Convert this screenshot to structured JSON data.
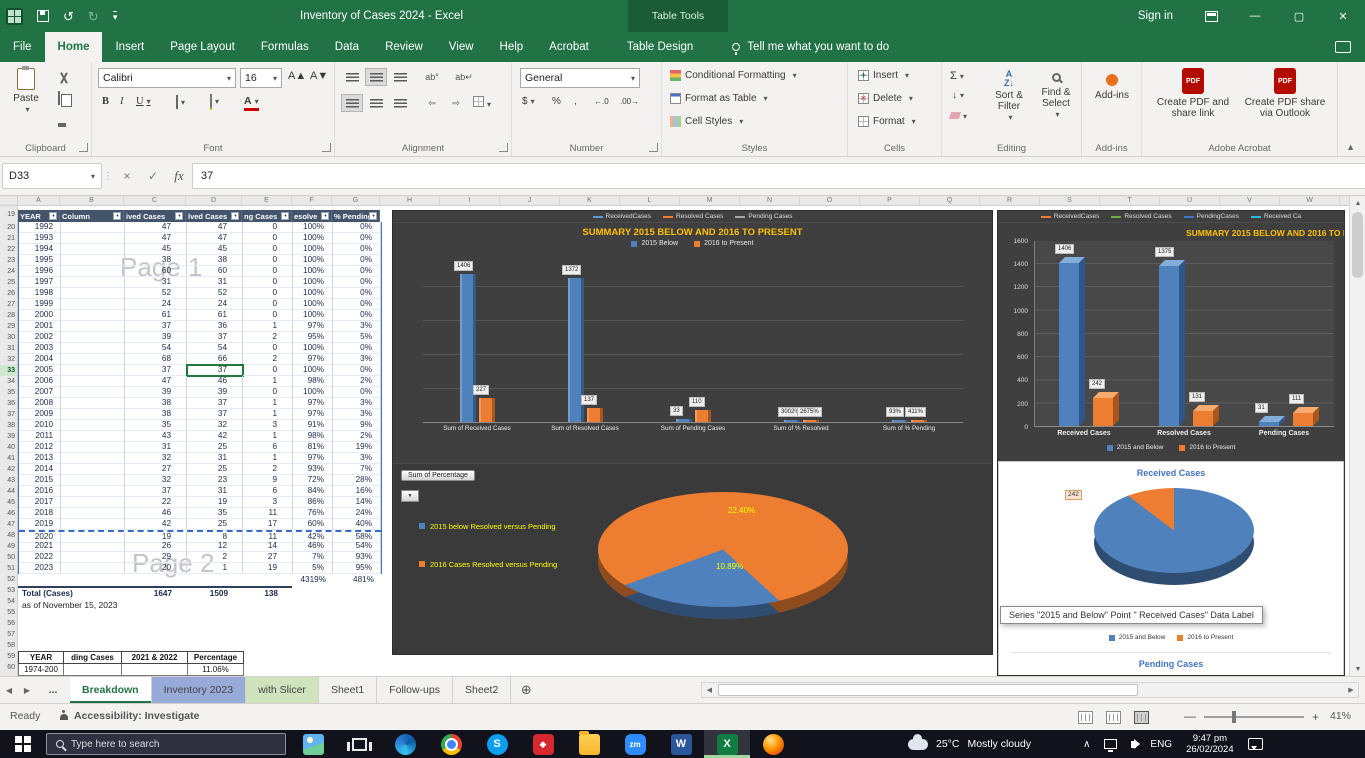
{
  "window": {
    "title": "Inventory of Cases 2024  -  Excel",
    "context_tab_group": "Table Tools",
    "sign_in": "Sign in"
  },
  "ribbon_tabs": [
    {
      "label": "File"
    },
    {
      "label": "Home",
      "active": true
    },
    {
      "label": "Insert"
    },
    {
      "label": "Page Layout"
    },
    {
      "label": "Formulas"
    },
    {
      "label": "Data"
    },
    {
      "label": "Review"
    },
    {
      "label": "View"
    },
    {
      "label": "Help"
    },
    {
      "label": "Acrobat"
    },
    {
      "label": "Table Design",
      "contextual": true
    }
  ],
  "tell_me": "Tell me what you want to do",
  "ribbon": {
    "clipboard": {
      "group": "Clipboard",
      "paste": "Paste"
    },
    "font": {
      "group": "Font",
      "family": "Calibri",
      "size": "16"
    },
    "alignment": {
      "group": "Alignment"
    },
    "number": {
      "group": "Number",
      "format": "General"
    },
    "styles": {
      "group": "Styles",
      "conditional": "Conditional Formatting",
      "format_table": "Format as Table",
      "cell_styles": "Cell Styles"
    },
    "cells": {
      "group": "Cells",
      "insert": "Insert",
      "delete": "Delete",
      "format": "Format"
    },
    "editing": {
      "group": "Editing",
      "sort_filter": "Sort & Filter",
      "find_select": "Find & Select"
    },
    "addins": {
      "group": "Add-ins",
      "label": "Add-ins"
    },
    "acrobat": {
      "group": "Adobe Acrobat",
      "btn1": "Create PDF and share link",
      "btn2": "Create PDF share via Outlook"
    }
  },
  "formula_bar": {
    "name_box": "D33",
    "fx": "fx",
    "value": "37"
  },
  "sheet": {
    "col_letters": [
      "A",
      "B",
      "C",
      "D",
      "E",
      "F",
      "G",
      "H",
      "I",
      "J",
      "K",
      "L",
      "M",
      "N",
      "O",
      "P",
      "Q",
      "R",
      "S",
      "T",
      "U",
      "V",
      "W"
    ],
    "row_start": 19,
    "row_end": 60,
    "selected_row_number": 33,
    "watermark_page1": "Page 1",
    "watermark_page2": "Page 2",
    "table": {
      "headers": [
        "YEAR",
        "Column",
        "ived Cases",
        "lved Cases",
        "ng Cases",
        "esolve",
        "% Pending"
      ],
      "rows": [
        [
          "1992",
          "",
          "47",
          "47",
          "0",
          "100%",
          "0%"
        ],
        [
          "1993",
          "",
          "47",
          "47",
          "0",
          "100%",
          "0%"
        ],
        [
          "1994",
          "",
          "45",
          "45",
          "0",
          "100%",
          "0%"
        ],
        [
          "1995",
          "",
          "38",
          "38",
          "0",
          "100%",
          "0%"
        ],
        [
          "1996",
          "",
          "60",
          "60",
          "0",
          "100%",
          "0%"
        ],
        [
          "1997",
          "",
          "31",
          "31",
          "0",
          "100%",
          "0%"
        ],
        [
          "1998",
          "",
          "52",
          "52",
          "0",
          "100%",
          "0%"
        ],
        [
          "1999",
          "",
          "24",
          "24",
          "0",
          "100%",
          "0%"
        ],
        [
          "2000",
          "",
          "61",
          "61",
          "0",
          "100%",
          "0%"
        ],
        [
          "2001",
          "",
          "37",
          "36",
          "1",
          "97%",
          "3%"
        ],
        [
          "2002",
          "",
          "39",
          "37",
          "2",
          "95%",
          "5%"
        ],
        [
          "2003",
          "",
          "54",
          "54",
          "0",
          "100%",
          "0%"
        ],
        [
          "2004",
          "",
          "68",
          "66",
          "2",
          "97%",
          "3%"
        ],
        [
          "2005",
          "",
          "37",
          "37",
          "0",
          "100%",
          "0%"
        ],
        [
          "2006",
          "",
          "47",
          "46",
          "1",
          "98%",
          "2%"
        ],
        [
          "2007",
          "",
          "39",
          "39",
          "0",
          "100%",
          "0%"
        ],
        [
          "2008",
          "",
          "38",
          "37",
          "1",
          "97%",
          "3%"
        ],
        [
          "2009",
          "",
          "38",
          "37",
          "1",
          "97%",
          "3%"
        ],
        [
          "2010",
          "",
          "35",
          "32",
          "3",
          "91%",
          "9%"
        ],
        [
          "2011",
          "",
          "43",
          "42",
          "1",
          "98%",
          "2%"
        ],
        [
          "2012",
          "",
          "31",
          "25",
          "6",
          "81%",
          "19%"
        ],
        [
          "2013",
          "",
          "32",
          "31",
          "1",
          "97%",
          "3%"
        ],
        [
          "2014",
          "",
          "27",
          "25",
          "2",
          "93%",
          "7%"
        ],
        [
          "2015",
          "",
          "32",
          "23",
          "9",
          "72%",
          "28%"
        ],
        [
          "2016",
          "",
          "37",
          "31",
          "6",
          "84%",
          "16%"
        ],
        [
          "2017",
          "",
          "22",
          "19",
          "3",
          "86%",
          "14%"
        ],
        [
          "2018",
          "",
          "46",
          "35",
          "11",
          "76%",
          "24%"
        ],
        [
          "2019",
          "",
          "42",
          "25",
          "17",
          "60%",
          "40%"
        ],
        [
          "2020",
          "",
          "19",
          "8",
          "11",
          "42%",
          "58%"
        ],
        [
          "2021",
          "",
          "26",
          "12",
          "14",
          "46%",
          "54%"
        ],
        [
          "2022",
          "",
          "29",
          "2",
          "27",
          "7%",
          "93%"
        ],
        [
          "2023",
          "",
          "20",
          "1",
          "19",
          "5%",
          "95%"
        ]
      ],
      "pct_total": [
        "4319%",
        "481%"
      ],
      "total_label": "Total (Cases)",
      "totals": [
        "1647",
        "1509",
        "138"
      ],
      "note": "as of November 15, 2023"
    },
    "mini_table": {
      "headers": [
        "YEAR",
        "ding Cases",
        "2021 & 2022",
        "Percentage"
      ],
      "partial_row": [
        "1974-200",
        "11.06%"
      ]
    }
  },
  "chart_data": [
    {
      "id": "summary-pivot-bar",
      "type": "bar",
      "title": "SUMMARY 2015 BELOW AND 2016 TO PRESENT",
      "categories": [
        "Sum of Received Cases",
        "Sum of Resolved Cases",
        "Sum of Pending Cases",
        "Sum of % Resolved",
        "Sum of % Pending"
      ],
      "series": [
        {
          "name": "2015 Below",
          "color": "#4f81bd",
          "values": [
            1406,
            1372,
            33,
            0,
            0
          ],
          "labels": [
            "1406",
            "1372",
            "33",
            "3002%",
            "93%"
          ]
        },
        {
          "name": "2016 to Present",
          "color": "#ed7d31",
          "values": [
            227,
            137,
            110,
            0,
            0
          ],
          "labels": [
            "227",
            "137",
            "110",
            "2675%",
            "411%"
          ]
        }
      ],
      "ylim": [
        0,
        1600
      ],
      "grid": true,
      "legend_position": "top"
    },
    {
      "id": "summary-3d-bar",
      "type": "bar",
      "title": "SUMMARY 2015 BELOW AND 2016 TO PRESENT",
      "categories": [
        "Received Cases",
        "Resolved Cases",
        "Pending Cases"
      ],
      "series": [
        {
          "name": "2015 and Below",
          "color": "#4f81bd",
          "values": [
            1406,
            1375,
            31
          ],
          "labels": [
            "1406",
            "1375",
            "31"
          ]
        },
        {
          "name": "2016 to Present",
          "color": "#ed7d31",
          "values": [
            242,
            131,
            111
          ],
          "labels": [
            "242",
            "131",
            "111"
          ]
        }
      ],
      "yticks": [
        0,
        200,
        400,
        600,
        800,
        1000,
        1200,
        1400,
        1600
      ],
      "ylim": [
        0,
        1600
      ],
      "legend_position": "bottom"
    },
    {
      "id": "percentage-pie",
      "type": "pie",
      "field_button": "Sum of Percentage",
      "slices": [
        {
          "label": "2016 Cases Resolved versus Pending",
          "value": 22.4,
          "display": "22.40%",
          "color": "#ed7d31"
        },
        {
          "label": "2015 below Resolved versus Pending",
          "value": 10.89,
          "display": "10.89%",
          "color": "#4f81bd"
        }
      ],
      "legend": [
        {
          "label": "2015 below Resolved versus Pending",
          "color": "#4f81bd"
        },
        {
          "label": "2016 Cases Resolved versus Pending",
          "color": "#ed7d31"
        }
      ]
    },
    {
      "id": "received-cases-pie",
      "type": "pie",
      "title": "Received Cases",
      "data_label": "242",
      "slices": [
        {
          "label": "2015 and Below",
          "value": 1406,
          "color": "#4f81bd"
        },
        {
          "label": "2016 to Present",
          "value": 242,
          "color": "#ed7d31"
        }
      ],
      "legend": [
        {
          "label": "2015 and Below",
          "color": "#4f81bd"
        },
        {
          "label": "2016 to Present",
          "color": "#ed7d31"
        }
      ],
      "next_title": "Pending Cases"
    }
  ],
  "legend_strips": {
    "center": [
      {
        "label": "ReceivedCases",
        "color": "#5b9bd5"
      },
      {
        "label": "Resolved Cases",
        "color": "#ed7d31"
      },
      {
        "label": "Pending Cases",
        "color": "#a5a5a5"
      }
    ],
    "right": [
      {
        "label": "ReceivedCases",
        "color": "#ed7d31"
      },
      {
        "label": "Resolved Cases",
        "color": "#70ad47"
      },
      {
        "label": "PendingCases",
        "color": "#4472c4"
      },
      {
        "label": "Received Ca",
        "color": "#2fb9d8"
      }
    ]
  },
  "tooltip": "Series \"2015 and Below\" Point \" Received Cases\" Data Label",
  "sheet_tabs": {
    "overflow": "...",
    "tabs": [
      {
        "label": "Breakdown",
        "active": true
      },
      {
        "label": "Inventory 2023",
        "color": "#98aad8"
      },
      {
        "label": "with Slicer",
        "color": "#cfe3bd"
      },
      {
        "label": "Sheet1"
      },
      {
        "label": "Follow-ups"
      },
      {
        "label": "Sheet2"
      }
    ]
  },
  "status_bar": {
    "mode": "Ready",
    "accessibility": "Accessibility: Investigate",
    "zoom": "41%"
  },
  "taskbar": {
    "search_placeholder": "Type here to search",
    "apps": [
      "photos",
      "task-view",
      "edge",
      "chrome",
      "skype",
      "media-app",
      "file-explorer",
      "zoom",
      "word",
      "excel",
      "firefox"
    ],
    "active_app": "excel",
    "weather_temp": "25°C",
    "weather_desc": "Mostly cloudy",
    "lang": "ENG",
    "time": "9:47 pm",
    "date": "26/02/2024"
  }
}
